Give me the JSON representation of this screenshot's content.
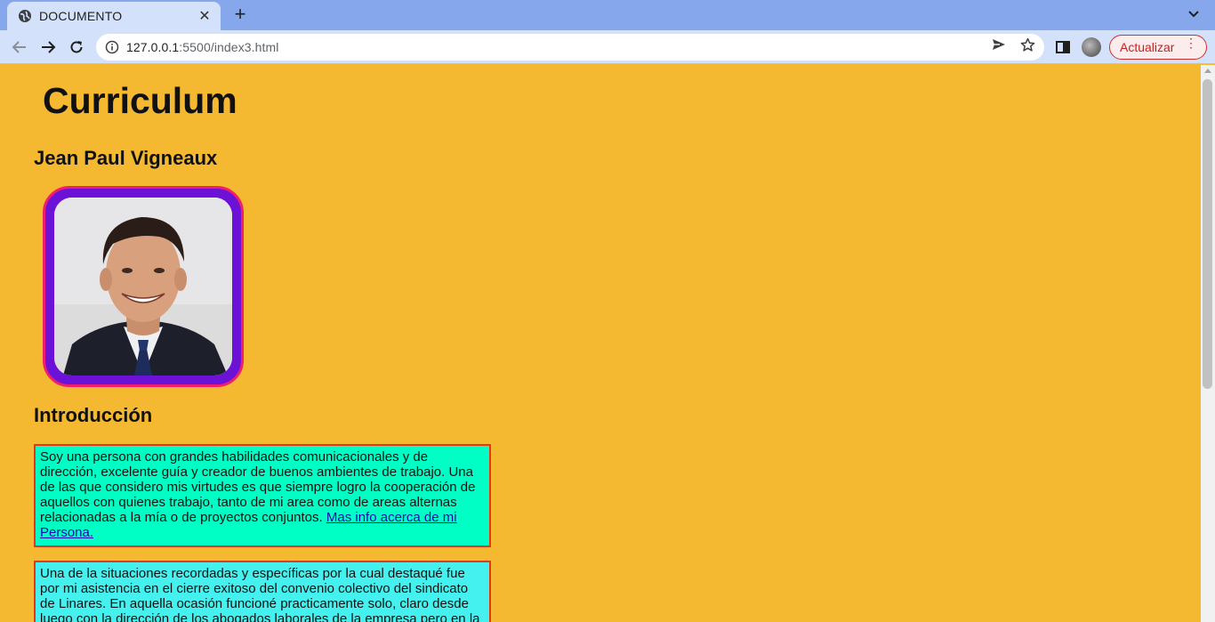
{
  "browser": {
    "tab_title": "DOCUMENTO",
    "url_host": "127.0.0.1",
    "url_rest": ":5500/index3.html",
    "update_label": "Actualizar",
    "update_menu": "⋮"
  },
  "page": {
    "title": "Curriculum",
    "name": "Jean Paul Vigneaux",
    "intro_heading": "Introducción",
    "paragraph1": "Soy una persona con grandes habilidades comunicacionales y de dirección, excelente guía y creador de buenos ambientes de trabajo. Una de las que considero mis virtudes es que siempre logro la cooperación de aquellos con quienes trabajo, tanto de mi area como de areas alternas relacionadas a la mía o de proyectos conjuntos.",
    "paragraph1_link": "Mas info acerca de mi Persona.",
    "paragraph2": "Una de la situaciones recordadas y específicas por la cual destaqué fue por mi asistencia en el cierre exitoso del convenio colectivo del sindicato de Linares. En aquella ocasión funcioné practicamente solo, claro desde luego con la dirección de los abogados laborales de la empresa pero en la"
  },
  "colors": {
    "page_bg": "#f5b931",
    "photo_border": "#f11f6b",
    "photo_frame": "#6b12d6",
    "para1_bg": "#00ffc5",
    "para2_bg": "#45f1ee",
    "para_border": "#e03b16"
  }
}
